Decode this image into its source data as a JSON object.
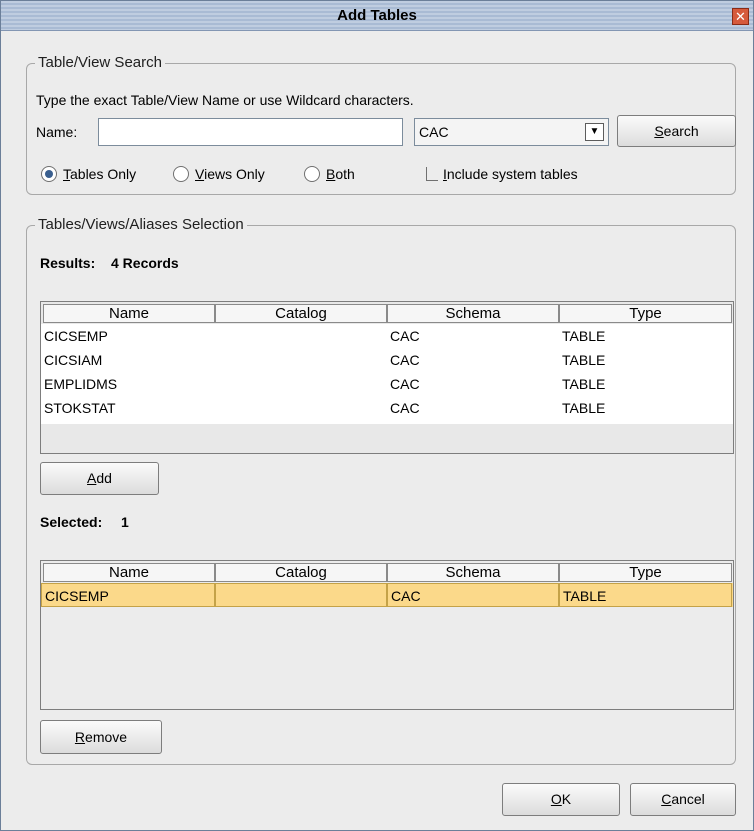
{
  "dialog": {
    "title": "Add Tables",
    "close_glyph": "✕"
  },
  "search_group": {
    "legend": "Table/View Search",
    "instructions": "Type the exact Table/View Name or use Wildcard characters.",
    "name_label": "Name:",
    "name_value": "",
    "schema_value": "CAC",
    "search_button": {
      "underline": "S",
      "rest": "earch"
    },
    "radios": [
      {
        "underline": "T",
        "rest": "ables Only",
        "selected": true
      },
      {
        "underline": "V",
        "rest": "iews Only",
        "selected": false
      },
      {
        "underline": "B",
        "rest": "oth",
        "selected": false
      }
    ],
    "include_system": {
      "underline": "I",
      "rest": "nclude system tables",
      "checked": false
    }
  },
  "selection_group": {
    "legend": "Tables/Views/Aliases Selection",
    "results_label": "Results:",
    "results_value": "4 Records",
    "columns": [
      "Name",
      "Catalog",
      "Schema",
      "Type"
    ],
    "results_rows": [
      {
        "name": "CICSEMP",
        "catalog": "",
        "schema": "CAC",
        "type": "TABLE"
      },
      {
        "name": "CICSIAM",
        "catalog": "",
        "schema": "CAC",
        "type": "TABLE"
      },
      {
        "name": "EMPLIDMS",
        "catalog": "",
        "schema": "CAC",
        "type": "TABLE"
      },
      {
        "name": "STOKSTAT",
        "catalog": "",
        "schema": "CAC",
        "type": "TABLE"
      }
    ],
    "add_button": {
      "underline": "A",
      "rest": "dd"
    },
    "selected_label": "Selected:",
    "selected_value": "1",
    "selected_rows": [
      {
        "name": "CICSEMP",
        "catalog": "",
        "schema": "CAC",
        "type": "TABLE"
      }
    ],
    "remove_button": {
      "underline": "R",
      "rest": "emove"
    }
  },
  "footer": {
    "ok_button": {
      "underline": "O",
      "rest": "K"
    },
    "cancel_button": {
      "underline": "C",
      "rest": "ancel"
    }
  }
}
